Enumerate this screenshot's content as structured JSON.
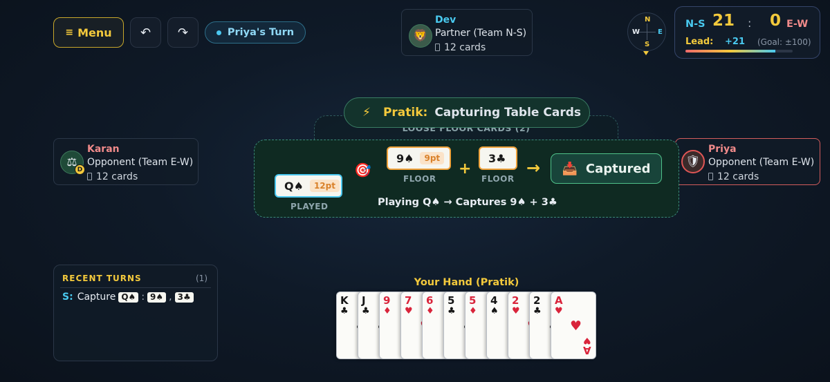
{
  "toolbar": {
    "menu_label": "Menu",
    "undo_icon": "↶",
    "redo_icon": "↷",
    "turn_label": "Priya's Turn"
  },
  "players": {
    "top": {
      "name": "Dev",
      "role": "Partner (Team N-S)",
      "cards": "12 cards",
      "avatar": "lion-icon"
    },
    "left": {
      "name": "Karan",
      "role": "Opponent (Team E-W)",
      "cards": "12 cards",
      "avatar": "scales-icon",
      "dealer_badge": "D"
    },
    "right": {
      "name": "Priya",
      "role": "Opponent (Team E-W)",
      "cards": "12 cards",
      "avatar": "shield-icon"
    }
  },
  "compass": {
    "n": "N",
    "s": "S",
    "w": "W",
    "e": "E",
    "active": "S"
  },
  "scoreboard": {
    "ns_label": "N-S",
    "ns_score": "21",
    "colon": ":",
    "ew_score": "0",
    "ew_label": "E-W",
    "lead_label": "Lead:",
    "lead_value": "+21",
    "goal": "(Goal: ±100)",
    "lead_fraction": 0.21
  },
  "action": {
    "bolt_icon": "⚡",
    "actor": "Pratik:",
    "text": "Capturing Table Cards"
  },
  "loose_floor_label": "LOOSE FLOOR CARDS (2)",
  "capture": {
    "played_card": "Q♠",
    "played_points": "12pt",
    "played_caption": "PLAYED",
    "target_icon": "🎯",
    "floor1_card": "9♠",
    "floor1_points": "9pt",
    "floor1_caption": "FLOOR",
    "plus": "+",
    "floor2_card": "3♣",
    "floor2_caption": "FLOOR",
    "arrow": "→",
    "captured_icon": "📥",
    "captured_label": "Captured",
    "summary": "Playing Q♠ → Captures 9♠ + 3♣"
  },
  "recent_turns": {
    "title": "RECENT TURNS",
    "count": "(1)",
    "entries": [
      {
        "seat": "S:",
        "action": "Capture",
        "played": "Q♠",
        "colon": ":",
        "cap1": "9♠",
        "comma": ",",
        "cap2": "3♣"
      }
    ]
  },
  "hand": {
    "title": "Your Hand (Pratik)",
    "cards": [
      {
        "rank": "K",
        "suit": "♣",
        "color": "black"
      },
      {
        "rank": "J",
        "suit": "♣",
        "color": "black"
      },
      {
        "rank": "9",
        "suit": "♦",
        "color": "red"
      },
      {
        "rank": "7",
        "suit": "♥",
        "color": "red"
      },
      {
        "rank": "6",
        "suit": "♦",
        "color": "red"
      },
      {
        "rank": "5",
        "suit": "♣",
        "color": "black"
      },
      {
        "rank": "5",
        "suit": "♦",
        "color": "red"
      },
      {
        "rank": "4",
        "suit": "♠",
        "color": "black"
      },
      {
        "rank": "2",
        "suit": "♥",
        "color": "red"
      },
      {
        "rank": "2",
        "suit": "♣",
        "color": "black"
      },
      {
        "rank": "A",
        "suit": "♥",
        "color": "red"
      }
    ]
  }
}
